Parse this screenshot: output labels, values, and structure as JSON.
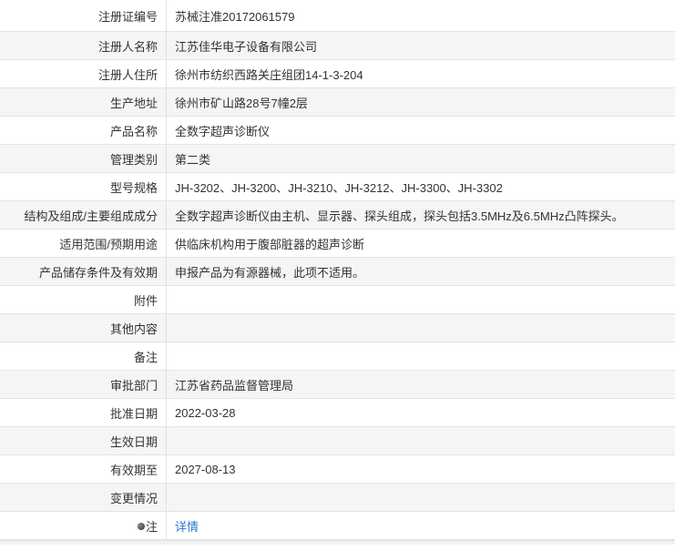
{
  "rows": [
    {
      "label": "注册证编号",
      "value": "苏械注准20172061579"
    },
    {
      "label": "注册人名称",
      "value": "江苏佳华电子设备有限公司"
    },
    {
      "label": "注册人住所",
      "value": "徐州市纺织西路关庄组团14-1-3-204"
    },
    {
      "label": "生产地址",
      "value": "徐州市矿山路28号7幢2层"
    },
    {
      "label": "产品名称",
      "value": "全数字超声诊断仪"
    },
    {
      "label": "管理类别",
      "value": "第二类"
    },
    {
      "label": "型号规格",
      "value": "JH-3202、JH-3200、JH-3210、JH-3212、JH-3300、JH-3302"
    },
    {
      "label": "结构及组成/主要组成成分",
      "value": "全数字超声诊断仪由主机、显示器、探头组成，探头包括3.5MHz及6.5MHz凸阵探头。"
    },
    {
      "label": "适用范围/预期用途",
      "value": "供临床机构用于腹部脏器的超声诊断"
    },
    {
      "label": "产品储存条件及有效期",
      "value": "申报产品为有源器械，此项不适用。"
    },
    {
      "label": "附件",
      "value": ""
    },
    {
      "label": "其他内容",
      "value": ""
    },
    {
      "label": "备注",
      "value": ""
    },
    {
      "label": "审批部门",
      "value": "江苏省药品监督管理局"
    },
    {
      "label": "批准日期",
      "value": "2022-03-28"
    },
    {
      "label": "生效日期",
      "value": ""
    },
    {
      "label": "有效期至",
      "value": "2027-08-13"
    },
    {
      "label": "变更情况",
      "value": ""
    }
  ],
  "note_row": {
    "label": "注",
    "icon": "note-icon",
    "link_text": "详情",
    "link_color": "#2a7ad5"
  }
}
